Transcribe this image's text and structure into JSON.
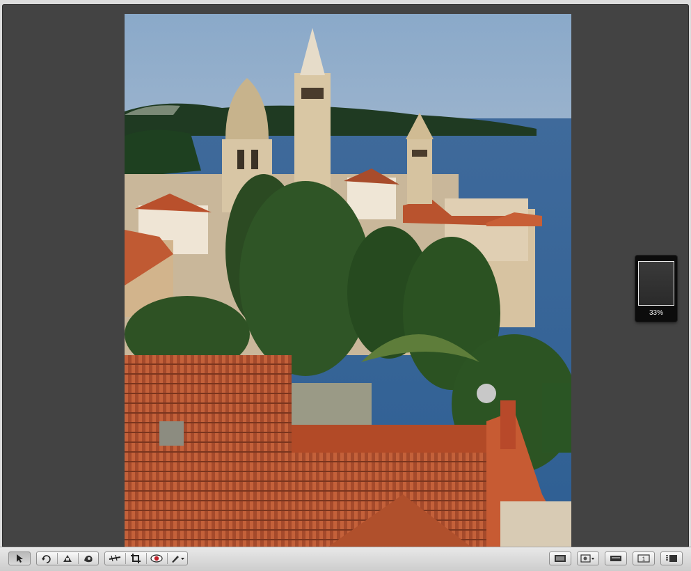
{
  "viewer": {
    "zoom_level": "33%"
  },
  "colors": {
    "viewer_background": "#434343",
    "toolbar_background": "#d8d8d8",
    "hud_background": "#0c0c0c"
  },
  "toolbar": {
    "left_tools": [
      {
        "icon": "pointer-arrow-icon",
        "active": true
      },
      {
        "icon": "rotate-icon"
      },
      {
        "icon": "straighten-icon"
      },
      {
        "icon": "retouch-icon"
      },
      {
        "icon": "adjust-icon"
      },
      {
        "icon": "crop-icon"
      },
      {
        "icon": "red-eye-icon"
      },
      {
        "icon": "brush-icon"
      }
    ],
    "right_tools": [
      {
        "icon": "viewer-mode-icon"
      },
      {
        "icon": "compare-icon"
      },
      {
        "icon": "filmstrip-icon"
      },
      {
        "icon": "single-view-icon",
        "label": "1"
      },
      {
        "icon": "list-view-icon"
      }
    ]
  }
}
